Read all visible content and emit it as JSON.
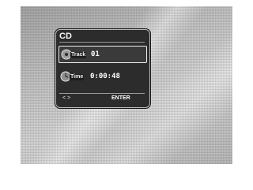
{
  "osd": {
    "title": "CD",
    "rows": [
      {
        "icon": "disc-icon",
        "label": "Track",
        "value": "01",
        "selected": true
      },
      {
        "icon": "clock-icon",
        "label": "Time",
        "value": "0:00:48",
        "selected": false
      }
    ],
    "footer": {
      "arrows": "< >",
      "enter": "ENTER"
    }
  }
}
